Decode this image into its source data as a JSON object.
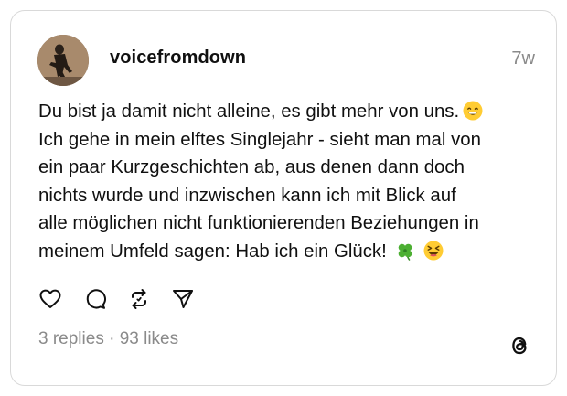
{
  "post": {
    "username": "voicefromdown",
    "timestamp": "7w",
    "text_lines": [
      "Du bist ja damit nicht alleine, es gibt mehr von uns.",
      "Ich gehe in mein elftes Singlejahr - sieht man mal von",
      "ein paar Kurzgeschichten ab, aus denen dann doch",
      "nichts wurde und inzwischen kann ich mit Blick auf",
      "alle möglichen nicht funktionierenden Beziehungen in",
      "meinem Umfeld sagen: Hab ich ein Glück!"
    ],
    "emojis": {
      "line1": "grinning-smiling-eyes-emoji",
      "line6": [
        "four-leaf-clover-emoji",
        "laughing-squinting-emoji"
      ]
    },
    "stats": "3 replies · 93 likes"
  },
  "actions": [
    {
      "name": "like",
      "icon": "heart-icon"
    },
    {
      "name": "reply",
      "icon": "comment-icon"
    },
    {
      "name": "repost",
      "icon": "repost-icon"
    },
    {
      "name": "share",
      "icon": "send-icon"
    }
  ],
  "brand_icon": "threads-logo-icon",
  "colors": {
    "text": "#101010",
    "muted": "#8a8a8a",
    "border": "#d9d9d9"
  }
}
